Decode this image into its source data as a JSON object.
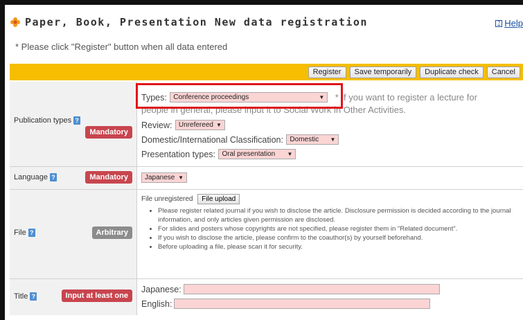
{
  "header": {
    "title": "Paper, Book, Presentation New data registration",
    "help_label": "Help",
    "note": "* Please click \"Register\" button when all data entered"
  },
  "toolbar": {
    "register_label": "Register",
    "save_temp_label": "Save temporarily",
    "duplicate_label": "Duplicate check",
    "cancel_label": "Cancel"
  },
  "publication": {
    "label": "Publication types",
    "badge": "Mandatory",
    "types_label": "Types:",
    "types_value": "Conference proceedings",
    "types_note": "* If you want to register a lecture for",
    "types_note2": "people in general, please input it to Social Work in Other Activities.",
    "review_label": "Review:",
    "review_value": "Unrefereed",
    "classification_label": "Domestic/International Classification:",
    "classification_value": "Domestic",
    "presentation_label": "Presentation types:",
    "presentation_value": "Oral presentation"
  },
  "language": {
    "label": "Language",
    "badge": "Mandatory",
    "value": "Japanese"
  },
  "file": {
    "label": "File",
    "badge": "Arbitrary",
    "status": "File unregistered",
    "upload_label": "File upload",
    "bullets": [
      "Please register related journal if you wish to disclose the article. Disclosure permission is decided according to the journal information, and only articles given permission are disclosed.",
      "For slides and posters whose copyrights are not specified, please register them in \"Related document\".",
      "If you wish to disclose the article, please confirm to the coauthor(s) by yourself beforehand.",
      "Before uploading a file, please scan it for security."
    ]
  },
  "title_field": {
    "label": "Title",
    "badge": "Input at least one",
    "japanese_label": "Japanese:",
    "english_label": "English:"
  },
  "colors": {
    "toolbar": "#f6be00",
    "badge_red": "#c8454e",
    "badge_gray": "#8c8c8c",
    "field_pink": "#fbd4d4",
    "highlight": "#e0151b"
  }
}
